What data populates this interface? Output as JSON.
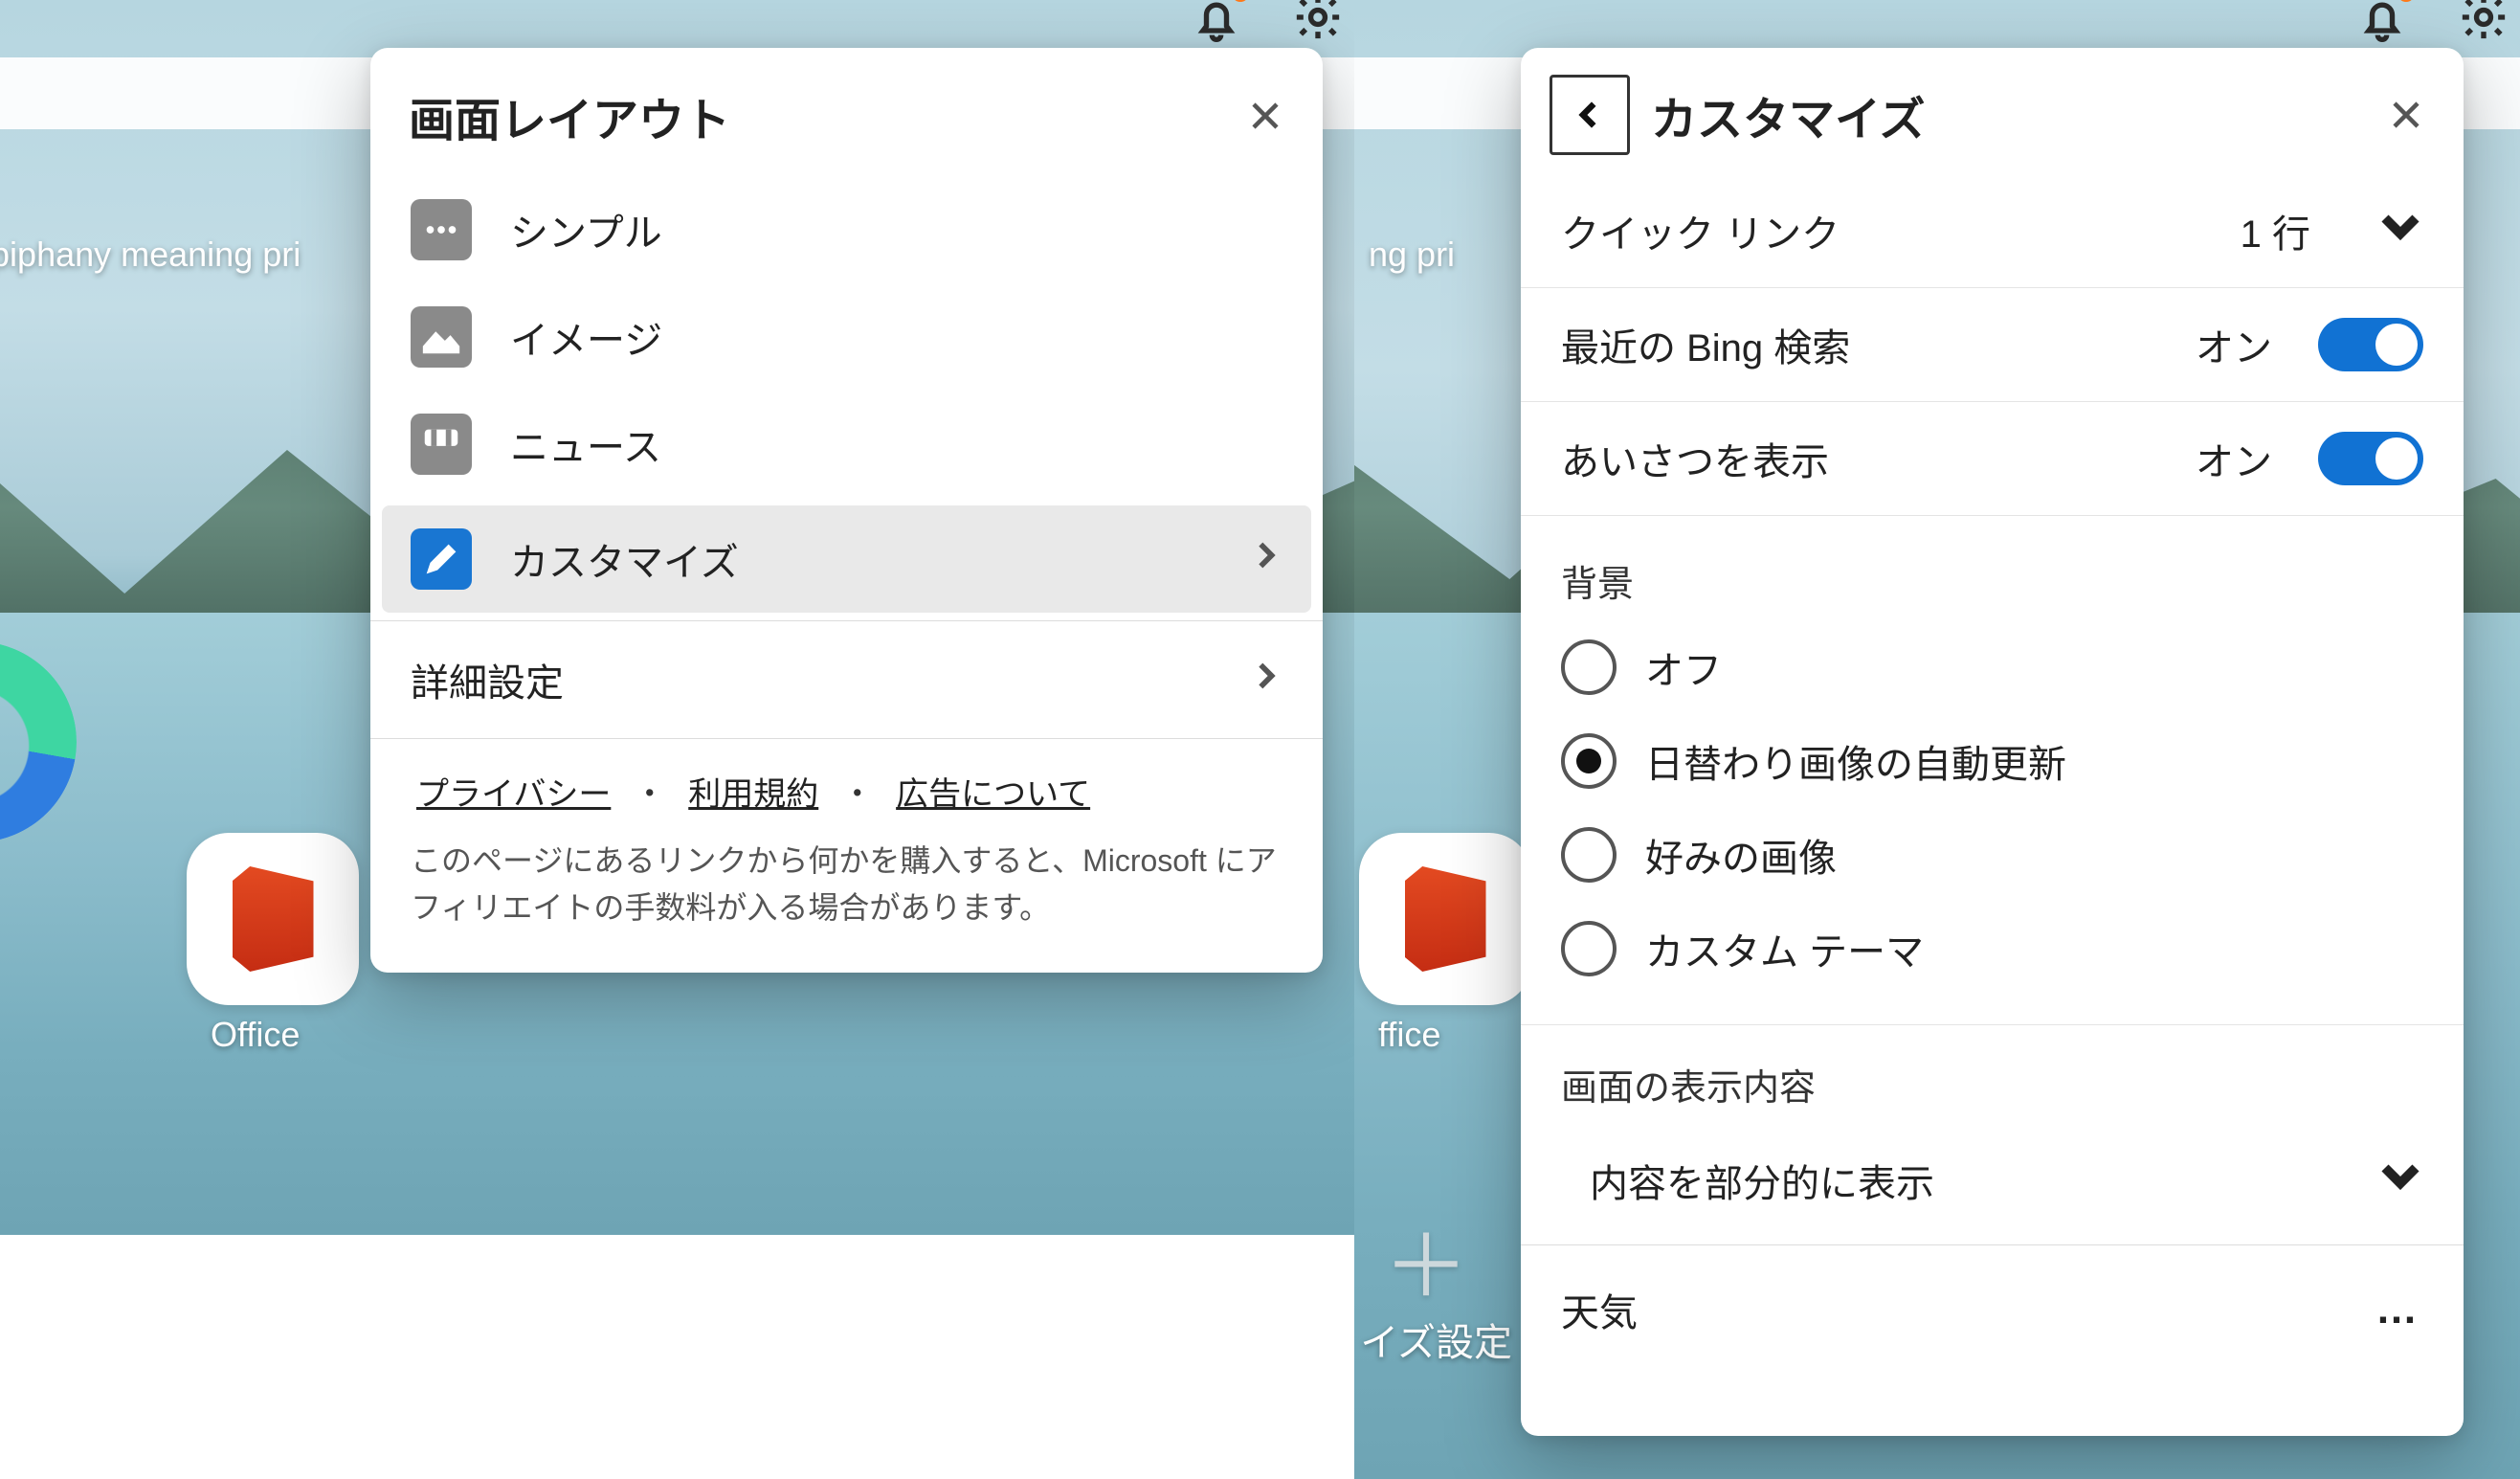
{
  "left": {
    "title": "画面レイアウト",
    "quicklinks": "epiphany meaning   pri",
    "office_label": "Office",
    "items": {
      "simple": {
        "label": "シンプル"
      },
      "image": {
        "label": "イメージ"
      },
      "news": {
        "label": "ニュース"
      },
      "custom": {
        "label": "カスタマイズ"
      },
      "advanced": {
        "label": "詳細設定"
      }
    },
    "footer": {
      "privacy": "プライバシー",
      "terms": "利用規約",
      "ads": "広告について",
      "disclaimer": "このページにあるリンクから何かを購入すると、Microsoft にアフィリエイトの手数料が入る場合があります。"
    }
  },
  "right": {
    "title": "カスタマイズ",
    "quicklinks_frag": "ng   pri",
    "office_label": "ffice",
    "quick_links": {
      "label": "クイック リンク",
      "value": "1 行"
    },
    "recent_bing": {
      "label": "最近の Bing 検索",
      "state": "オン"
    },
    "greeting": {
      "label": "あいさつを表示",
      "state": "オン"
    },
    "background": {
      "title": "背景",
      "options": {
        "off": "オフ",
        "daily": "日替わり画像の自動更新",
        "fav": "好みの画像",
        "theme": "カスタム テーマ"
      }
    },
    "display": {
      "title": "画面の表示内容",
      "partial": "内容を部分的に表示"
    },
    "weather": {
      "label": "天気"
    },
    "behind_label": "イズ設定"
  }
}
